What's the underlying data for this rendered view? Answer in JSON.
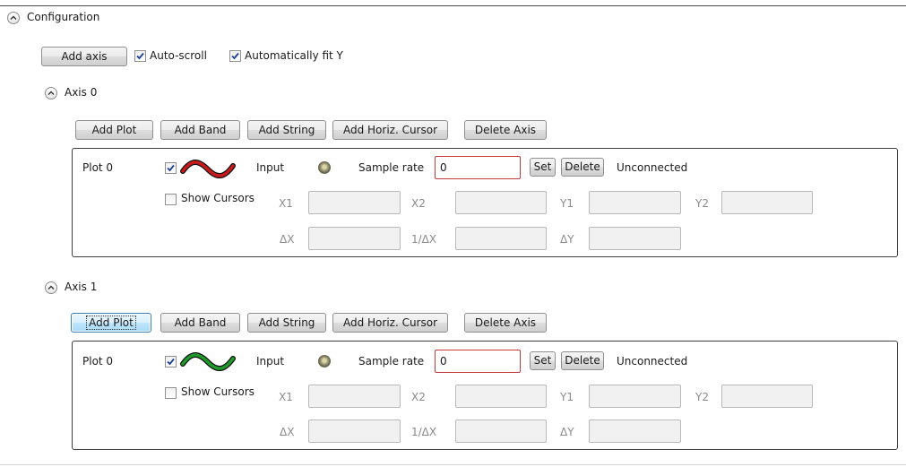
{
  "configuration": {
    "title": "Configuration",
    "add_axis_label": "Add axis",
    "auto_scroll_label": "Auto-scroll",
    "auto_scroll_checked": true,
    "auto_fit_label": "Automatically fit Y",
    "auto_fit_checked": true
  },
  "colors": {
    "plot_red": "#c81a1a",
    "plot_green": "#1f9a2a",
    "sample_rate_border": "#c23a3a",
    "focus_blue": "#3c7fb1"
  },
  "axes": [
    {
      "title": "Axis 0",
      "buttons": [
        "Add Plot",
        "Add Band",
        "Add String",
        "Add Horiz. Cursor",
        "Delete Axis"
      ],
      "plot": {
        "name": "Plot 0",
        "visible_checked": true,
        "trace_icon": "red-wave-icon",
        "input_label": "Input",
        "input_led_icon": "status-led-icon",
        "sample_rate_label": "Sample rate",
        "sample_rate_value": "0",
        "set_label": "Set",
        "delete_label": "Delete",
        "status": "Unconnected",
        "show_cursors_label": "Show Cursors",
        "show_cursors_checked": false,
        "cursor_labels": {
          "x1": "X1",
          "x2": "X2",
          "y1": "Y1",
          "y2": "Y2",
          "dx": "ΔX",
          "inv_dx": "1/ΔX",
          "dy": "ΔY"
        }
      }
    },
    {
      "title": "Axis 1",
      "buttons": [
        "Add Plot",
        "Add Band",
        "Add String",
        "Add Horiz. Cursor",
        "Delete Axis"
      ],
      "focused_button": "Add Plot",
      "plot": {
        "name": "Plot 0",
        "visible_checked": true,
        "trace_icon": "green-wave-icon",
        "input_label": "Input",
        "input_led_icon": "status-led-icon",
        "sample_rate_label": "Sample rate",
        "sample_rate_value": "0",
        "set_label": "Set",
        "delete_label": "Delete",
        "status": "Unconnected",
        "show_cursors_label": "Show Cursors",
        "show_cursors_checked": false,
        "cursor_labels": {
          "x1": "X1",
          "x2": "X2",
          "y1": "Y1",
          "y2": "Y2",
          "dx": "ΔX",
          "inv_dx": "1/ΔX",
          "dy": "ΔY"
        }
      }
    }
  ]
}
